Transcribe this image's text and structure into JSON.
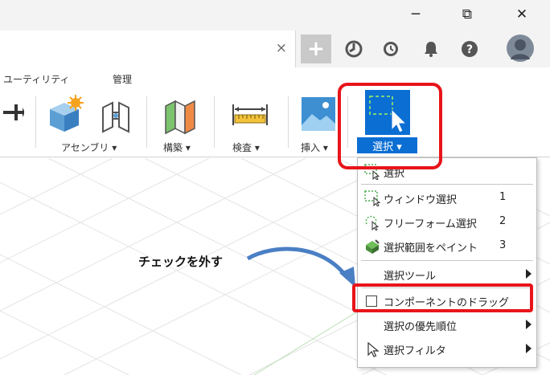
{
  "window": {
    "minimize": "─",
    "maximize": "⧉",
    "close": "✕"
  },
  "tabbar": {
    "close_tab": "×",
    "add": "+",
    "icons": [
      "job-status-icon",
      "history-icon",
      "notifications-icon",
      "help-icon",
      "user-avatar"
    ]
  },
  "ribbon": {
    "categories": [
      "ユーティリティ",
      "管理"
    ],
    "groups": {
      "assemble": "アセンブリ ▾",
      "construct": "構築 ▾",
      "inspect": "検査 ▾",
      "insert": "挿入 ▾",
      "select": "選択 ▾"
    }
  },
  "dropdown": {
    "items": [
      {
        "label": "選択",
        "shortcut": ""
      },
      {
        "label": "ウィンドウ選択",
        "shortcut": "1"
      },
      {
        "label": "フリーフォーム選択",
        "shortcut": "2"
      },
      {
        "label": "選択範囲をペイント",
        "shortcut": "3"
      },
      {
        "label": "選択ツール",
        "shortcut": ""
      },
      {
        "label": "コンポーネントのドラッグ",
        "shortcut": "",
        "checked": false
      },
      {
        "label": "選択の優先順位",
        "shortcut": ""
      },
      {
        "label": "選択フィルタ",
        "shortcut": ""
      }
    ]
  },
  "annotation": {
    "text": "チェックを外す"
  },
  "colors": {
    "accent": "#0b6ed3",
    "highlight": "#e8141a",
    "arrow": "#4a7fc4"
  }
}
